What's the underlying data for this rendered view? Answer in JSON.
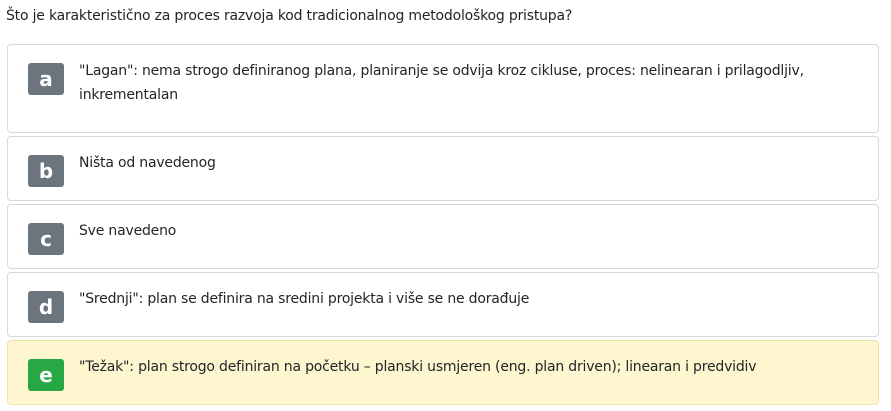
{
  "question": {
    "text": "Što je karakteristično za proces razvoja kod tradicionalnog metodološkog pristupa?"
  },
  "options": [
    {
      "letter": "a",
      "text": "\"Lagan\": nema strogo definiranog plana, planiranje se odvija kroz cikluse, proces: nelinearan i prilagodljiv, inkrementalan",
      "selected": false
    },
    {
      "letter": "b",
      "text": "Ništa od navedenog",
      "selected": false
    },
    {
      "letter": "c",
      "text": "Sve navedeno",
      "selected": false
    },
    {
      "letter": "d",
      "text": "\"Srednji\": plan se definira na sredini projekta i više se ne dorađuje",
      "selected": false
    },
    {
      "letter": "e",
      "text": "\"Težak\": plan strogo definiran na početku – planski usmjeren (eng. plan driven); linearan i predvidiv",
      "selected": true
    }
  ],
  "colors": {
    "letter_badge": "#6c757d",
    "letter_badge_selected": "#27a844",
    "selected_background": "#fdf6cf",
    "border": "#d5d8dc"
  }
}
